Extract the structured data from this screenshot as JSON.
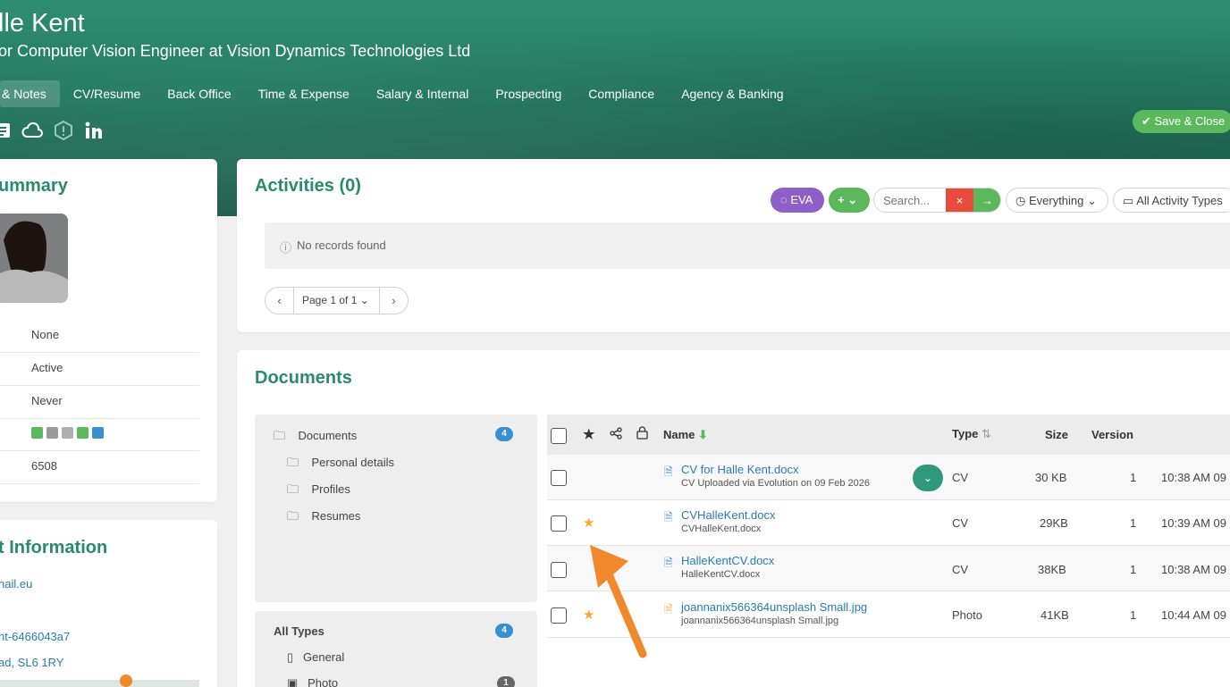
{
  "header": {
    "name": "lle Kent",
    "subtitle": "or Computer Vision Engineer at Vision Dynamics Technologies Ltd",
    "tabs": [
      "& Notes",
      "CV/Resume",
      "Back Office",
      "Time & Expense",
      "Salary & Internal",
      "Prospecting",
      "Compliance",
      "Agency & Banking"
    ],
    "icons": [
      "id-card-icon",
      "cloud-icon",
      "warning-icon",
      "linkedin-icon"
    ],
    "save_close": "✔ Save & Close"
  },
  "summary": {
    "title": "ummary",
    "rows": [
      "None",
      "Active",
      "Never",
      "",
      "6508"
    ]
  },
  "contact": {
    "title": "t Information",
    "email": "nail.eu",
    "ref": "nt-6466043a7",
    "address": "ad, SL6 1RY"
  },
  "activities": {
    "title": "Activities (0)",
    "eva": "EVA",
    "add": "+ ⌄",
    "search_placeholder": "Search...",
    "clear": "×",
    "go": "→",
    "filter_time": "Everything",
    "filter_type": "All Activity Types",
    "empty": "No records found",
    "pager": "Page 1 of 1",
    "prev": "‹",
    "next": "›"
  },
  "documents": {
    "title": "Documents",
    "tree": {
      "root": "Documents",
      "root_count": "4",
      "folders": [
        "Personal details",
        "Profiles",
        "Resumes"
      ]
    },
    "types": {
      "title": "All Types",
      "count": "4",
      "items": [
        "General",
        "Photo"
      ],
      "photo_count": "1"
    },
    "columns": {
      "name": "Name",
      "type": "Type",
      "size": "Size",
      "version": "Version"
    },
    "rows": [
      {
        "name": "CV for Halle Kent.docx",
        "sub": "CV Uploaded via Evolution on 09 Feb 2026",
        "type": "CV",
        "size": "30 KB",
        "version": "1",
        "time": "10:38 AM 09",
        "starred": false,
        "icon": "word-doc-icon"
      },
      {
        "name": "CVHalleKent.docx",
        "sub": "CVHalleKent.docx",
        "type": "CV",
        "size": "29KB",
        "version": "1",
        "time": "10:39 AM 09",
        "starred": true,
        "icon": "word-doc-icon"
      },
      {
        "name": "HalleKentCV.docx",
        "sub": "HalleKentCV.docx",
        "type": "CV",
        "size": "38KB",
        "version": "1",
        "time": "10:38 AM 09",
        "starred": false,
        "icon": "word-doc-icon"
      },
      {
        "name": "joannanix566364unsplash Small.jpg",
        "sub": "joannanix566364unsplash Small.jpg",
        "type": "Photo",
        "size": "41KB",
        "version": "1",
        "time": "10:44 AM 09",
        "starred": true,
        "icon": "image-file-icon"
      }
    ]
  },
  "colors": {
    "brand_green": "#2a8a6d",
    "save_green": "#5cb85c",
    "eva_purple": "#8e5fc6",
    "star": "#f0ad31",
    "annotation_arrow": "#f0892c",
    "link_blue": "#2a7ab0"
  }
}
